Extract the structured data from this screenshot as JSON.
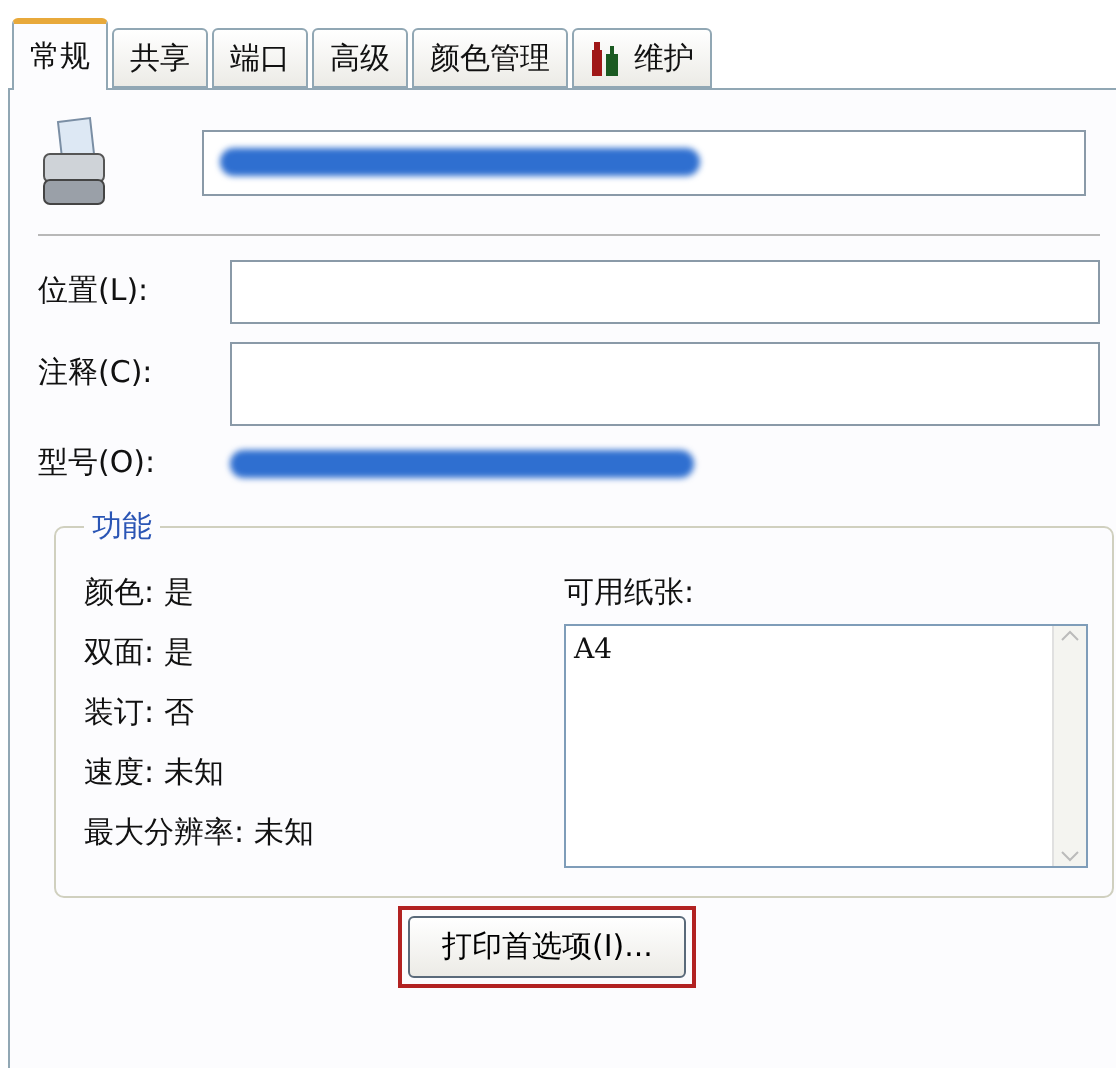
{
  "tabs": [
    {
      "label": "常规",
      "selected": true
    },
    {
      "label": "共享",
      "selected": false
    },
    {
      "label": "端口",
      "selected": false
    },
    {
      "label": "高级",
      "selected": false
    },
    {
      "label": "颜色管理",
      "selected": false
    },
    {
      "label": "维护",
      "selected": false,
      "icon": true
    }
  ],
  "printer_name": {
    "redacted": true
  },
  "fields": [
    {
      "label": "位置(L):",
      "kind": "single"
    },
    {
      "label": "注释(C):",
      "kind": "multi"
    }
  ],
  "model": {
    "label": "型号(O):",
    "redacted": true
  },
  "features": {
    "title": "功能",
    "items": [
      {
        "label": "颜色:",
        "value": "是"
      },
      {
        "label": "双面:",
        "value": "是"
      },
      {
        "label": "装订:",
        "value": "否"
      },
      {
        "label": "速度:",
        "value": "未知"
      },
      {
        "label": "最大分辨率:",
        "value": "未知"
      }
    ],
    "paper_label": "可用纸张:",
    "papers": [
      "A4"
    ]
  },
  "button": {
    "label": "打印首选项(I)...",
    "highlighted": true
  }
}
